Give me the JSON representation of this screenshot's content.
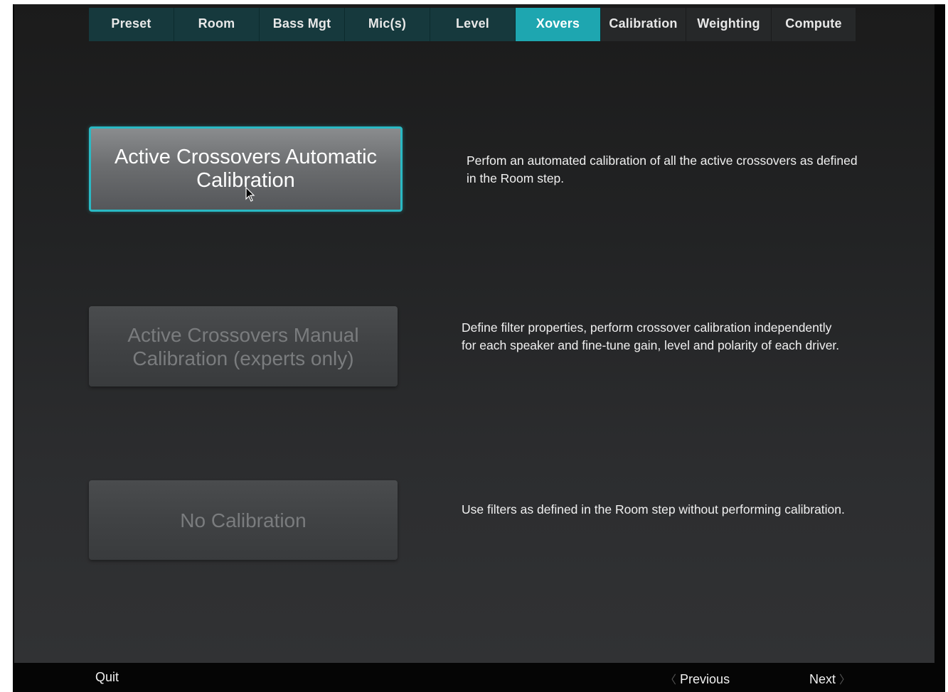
{
  "tabs": [
    {
      "label": "Preset",
      "state": "done"
    },
    {
      "label": "Room",
      "state": "done"
    },
    {
      "label": "Bass Mgt",
      "state": "done"
    },
    {
      "label": "Mic(s)",
      "state": "done"
    },
    {
      "label": "Level",
      "state": "done"
    },
    {
      "label": "Xovers",
      "state": "active"
    },
    {
      "label": "Calibration",
      "state": "todo"
    },
    {
      "label": "Weighting",
      "state": "todo"
    },
    {
      "label": "Compute",
      "state": "todo"
    }
  ],
  "options": {
    "auto": {
      "line1": "Active Crossovers Automatic",
      "line2": "Calibration",
      "description": "Perfom an automated calibration of all the active crossovers as defined in the Room step."
    },
    "manual": {
      "line1": "Active Crossovers Manual",
      "line2": "Calibration (experts only)",
      "description": "Define filter properties, perform crossover calibration independently for each speaker and fine-tune gain, level and polarity of each driver."
    },
    "none": {
      "label": "No Calibration",
      "description": "Use filters as defined in the Room step without performing calibration."
    }
  },
  "footer": {
    "quit": "Quit",
    "previous": "Previous",
    "next": "Next",
    "prev_chevron": "〈",
    "next_chevron": "〉"
  },
  "colors": {
    "accent": "#1ea6b0",
    "tab_done": "#16393d",
    "tab_todo": "#262829",
    "button_border_selected": "#2ab9c4"
  }
}
